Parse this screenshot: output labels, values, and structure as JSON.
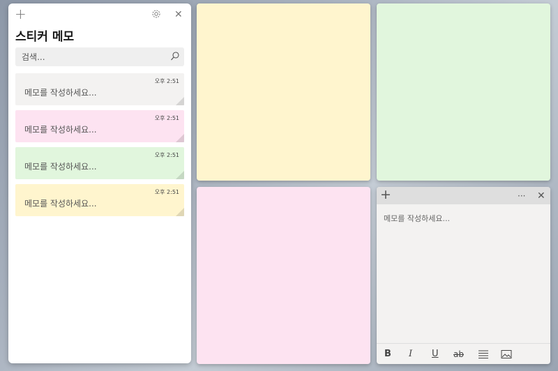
{
  "list": {
    "title": "스티커 메모",
    "add_glyph": "+",
    "settings_icon": "gear-icon",
    "close_glyph": "✕",
    "search_placeholder": "검색...",
    "notes": [
      {
        "time": "오후 2:51",
        "text": "메모를 작성하세요...",
        "color": "#f3f2f1"
      },
      {
        "time": "오후 2:51",
        "text": "메모를 작성하세요...",
        "color": "#fde3f1"
      },
      {
        "time": "오후 2:51",
        "text": "메모를 작성하세요...",
        "color": "#e1f6dd"
      },
      {
        "time": "오후 2:51",
        "text": "메모를 작성하세요...",
        "color": "#fff5ce"
      }
    ]
  },
  "stickies": {
    "yellow_color": "#fff5ce",
    "green_color": "#e1f6dd",
    "pink_color": "#fde3f1"
  },
  "editor": {
    "add_glyph": "+",
    "more_glyph": "···",
    "close_glyph": "✕",
    "placeholder": "메모를 작성하세요...",
    "toolbar": {
      "bold": "B",
      "italic": "I",
      "underline": "U",
      "strike": "ab",
      "list_icon": "list-icon",
      "image_icon": "image-icon"
    }
  }
}
